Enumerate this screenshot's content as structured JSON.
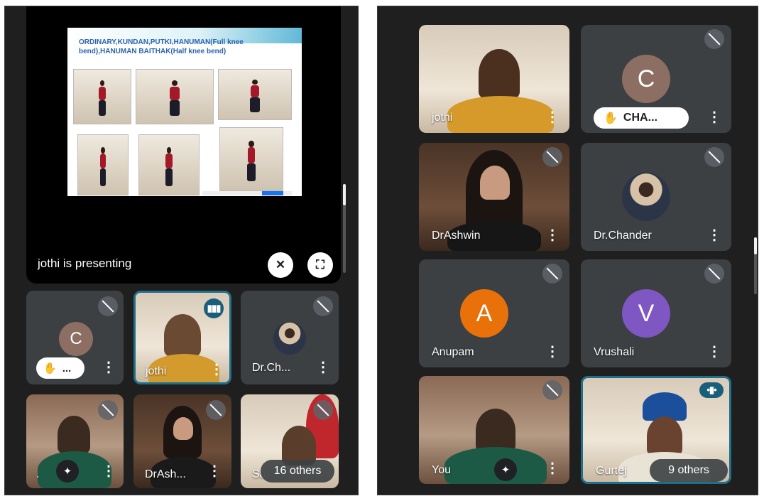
{
  "left": {
    "slide": {
      "title": "ORDINARY,KUNDAN,PUTKI,HANUMAN(Full knee bend),HANUMAN BAITHAK(Half knee bend)"
    },
    "presenting_label": "jothi is presenting",
    "tiles": [
      {
        "name": "",
        "avatar_letter": "C",
        "avatar_color": "#8d6e63",
        "hand_label": "..."
      },
      {
        "name": "jothi"
      },
      {
        "name": "Dr.Ch..."
      },
      {
        "name": "."
      },
      {
        "name": "DrAsh..."
      },
      {
        "name": "Sa",
        "others_label": "16 others"
      }
    ]
  },
  "right": {
    "tiles": [
      {
        "name": "jothi"
      },
      {
        "name": "",
        "avatar_letter": "C",
        "avatar_color": "#8d6e63",
        "hand_label": "CHA..."
      },
      {
        "name": "DrAshwin"
      },
      {
        "name": "Dr.Chander"
      },
      {
        "name": "Anupam",
        "avatar_letter": "A",
        "avatar_color": "#e8710a"
      },
      {
        "name": "Vrushali",
        "avatar_letter": "V",
        "avatar_color": "#7e57c2"
      },
      {
        "name": "You"
      },
      {
        "name": "Gurtej",
        "others_label": "9 others"
      }
    ]
  },
  "icons": {
    "more": "⋮",
    "hand": "✋",
    "spark": "✦",
    "fullscreen": "⛶",
    "unpin": "✕"
  }
}
